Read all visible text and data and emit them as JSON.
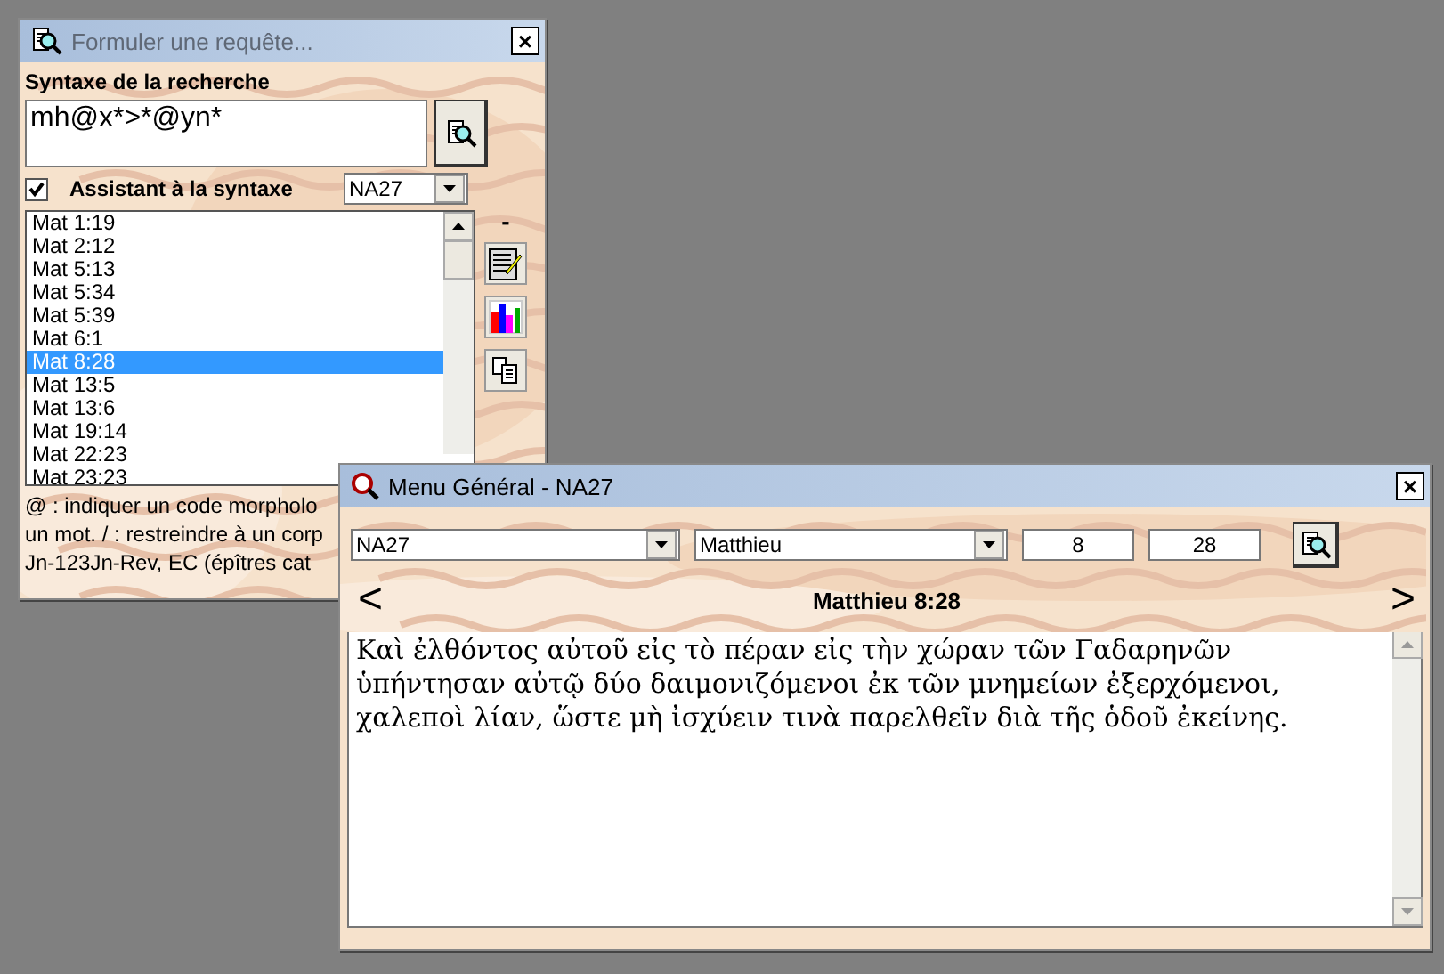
{
  "query_window": {
    "title": "Formuler une requête...",
    "active": false,
    "close": "×",
    "syntax_label": "Syntaxe de la recherche",
    "query": "mh@x*>*@yn*",
    "assistant": {
      "label": "Assistant à la syntaxe",
      "checked": true
    },
    "corpus": "NA27",
    "side_mark": "-",
    "results": [
      {
        "label": "Mat 1:19",
        "selected": false
      },
      {
        "label": "Mat 2:12",
        "selected": false
      },
      {
        "label": "Mat 5:13",
        "selected": false
      },
      {
        "label": "Mat 5:34",
        "selected": false
      },
      {
        "label": "Mat 5:39",
        "selected": false
      },
      {
        "label": "Mat 6:1",
        "selected": false
      },
      {
        "label": "Mat 8:28",
        "selected": true
      },
      {
        "label": "Mat 13:5",
        "selected": false
      },
      {
        "label": "Mat 13:6",
        "selected": false
      },
      {
        "label": "Mat 19:14",
        "selected": false
      },
      {
        "label": "Mat 22:23",
        "selected": false
      },
      {
        "label": "Mat 23:23",
        "selected": false
      }
    ],
    "help_lines": [
      "@ : indiquer un code morpholo",
      "un mot. / : restreindre à un corp",
      "Jn-123Jn-Rev, EC (épîtres cat"
    ]
  },
  "main_window": {
    "title": "Menu Général - NA27",
    "active": true,
    "close": "×",
    "edition": "NA27",
    "book": "Matthieu",
    "chapter": "8",
    "verse": "28",
    "prev": "<",
    "next": ">",
    "heading": "Matthieu 8:28",
    "text": "Καὶ ἐλθόντος αὐτοῦ εἰς τὸ πέραν εἰς τὴν χώραν τῶν Γαδαρηνῶν ὑπήντησαν αὐτῷ δύο δαιμονιζόμενοι ἐκ τῶν μνημείων ἐξερχόμενοι, χαλεποὶ λίαν, ὥστε μὴ ἰσχύειν τινὰ παρελθεῖν διὰ τῆς ὁδοῦ ἐκείνης."
  }
}
